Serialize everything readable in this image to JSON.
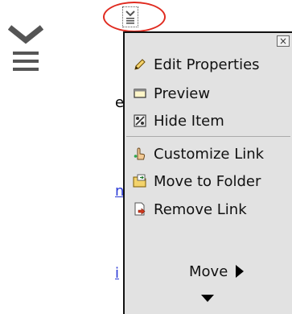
{
  "background": {
    "fragments": [
      {
        "text": "e",
        "link": false
      },
      {
        "text": "n",
        "link": true
      },
      {
        "text": "i",
        "link": true
      }
    ]
  },
  "menu": {
    "close_glyph": "×",
    "items": [
      {
        "label": "Edit Properties",
        "icon": "pencil-icon"
      },
      {
        "label": "Preview",
        "icon": "preview-window-icon"
      },
      {
        "label": "Hide Item",
        "icon": "hide-item-icon"
      },
      {
        "label": "Customize Link",
        "icon": "customize-hand-icon"
      },
      {
        "label": "Move to Folder",
        "icon": "folder-move-icon"
      },
      {
        "label": "Remove Link",
        "icon": "remove-link-icon"
      }
    ],
    "move_label": "Move"
  },
  "colors": {
    "highlight_ring": "#e02a1f",
    "menu_background": "#e2e2e2",
    "link": "#2a3ad6"
  }
}
